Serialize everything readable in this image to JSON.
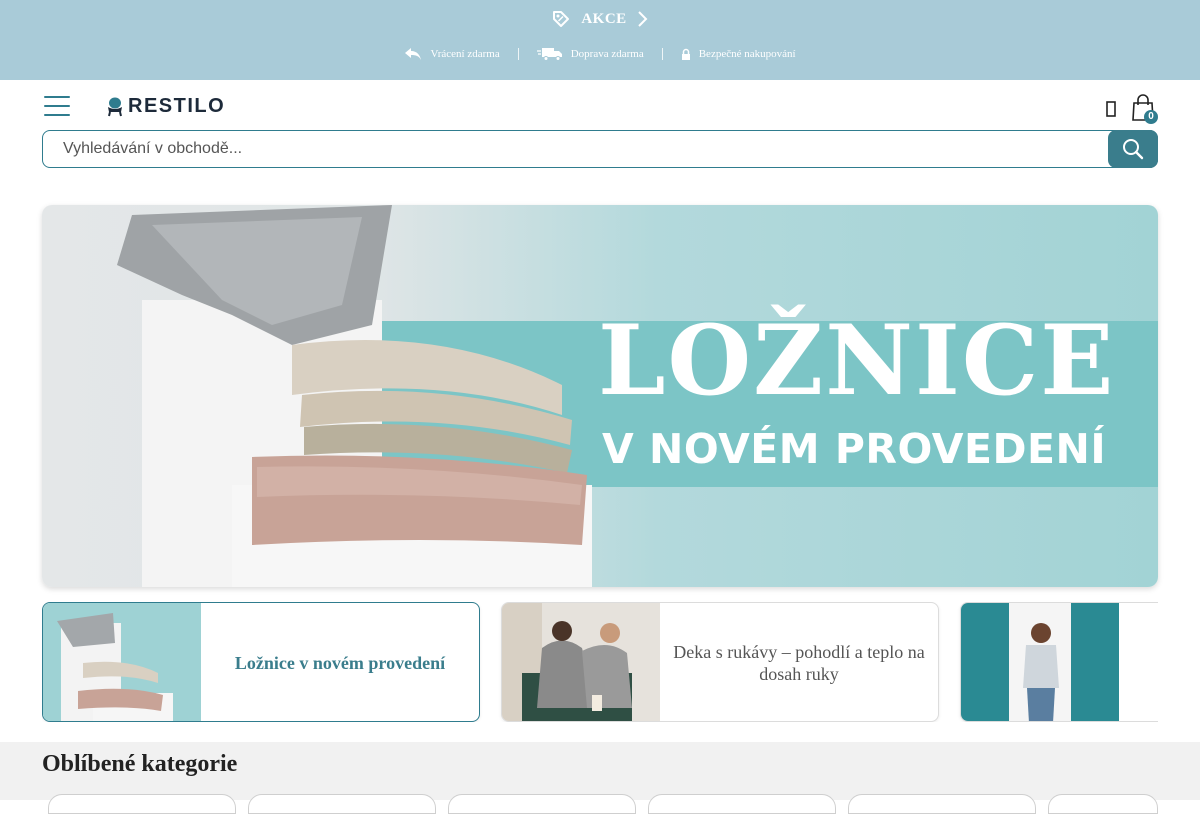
{
  "promo": {
    "label": "AKCE"
  },
  "usps": [
    {
      "icon": "return-arrow-icon",
      "label": "Vrácení zdarma"
    },
    {
      "icon": "delivery-truck-icon",
      "label": "Doprava zdarma"
    },
    {
      "icon": "lock-icon",
      "label": "Bezpečné nakupování"
    }
  ],
  "header": {
    "logo_text": "RESTILO",
    "cart_count": "0"
  },
  "search": {
    "placeholder": "Vyhledávání v obchodě..."
  },
  "hero": {
    "title": "LOŽNICE",
    "subtitle": "V NOVÉM PROVEDENÍ"
  },
  "cards": [
    {
      "label": "Ložnice v novém provedení",
      "active": true
    },
    {
      "label": "Deka s rukávy – pohodlí a teplo na dosah ruky",
      "active": false
    },
    {
      "label": "",
      "active": false
    }
  ],
  "favorites": {
    "title": "Oblíbené kategorie"
  },
  "colors": {
    "accent": "#2f7c8e",
    "topbar": "#a9cbd8",
    "hero_teal": "#7cc5c6"
  }
}
